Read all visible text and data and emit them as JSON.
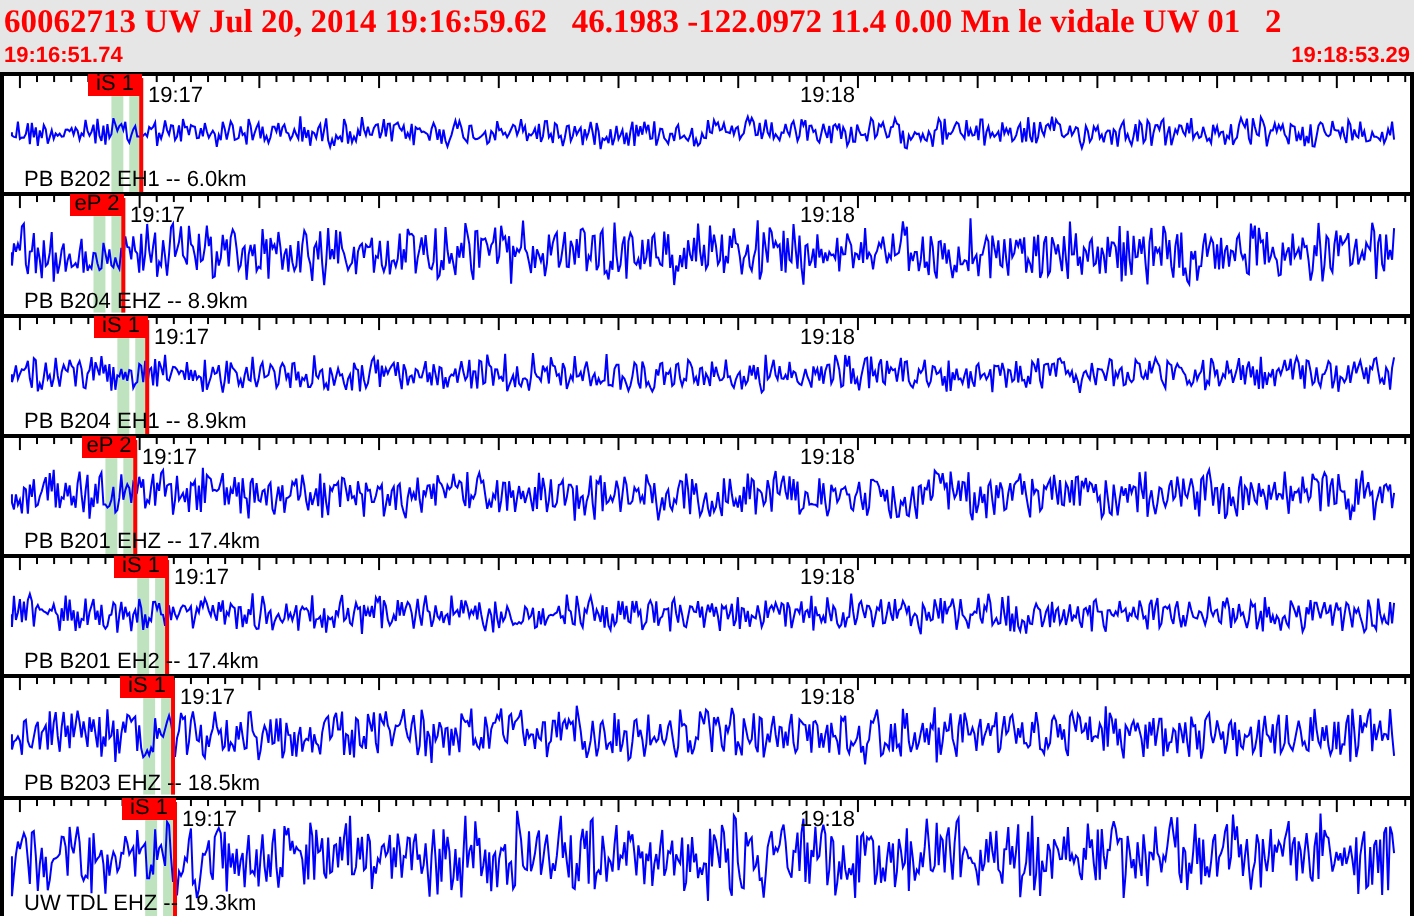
{
  "header": {
    "title": "60062713 UW Jul 20, 2014 19:16:59.62   46.1983 -122.0972 11.4 0.00 Mn le vidale UW 01   2",
    "start_time": "19:16:51.74",
    "end_time": "19:18:53.29"
  },
  "traces": [
    {
      "channel": "PB B202 EH1 -- 6.0km",
      "tick_labels": [
        "19:17",
        "19:18"
      ],
      "pick": "iS 1"
    },
    {
      "channel": "PB B204 EHZ -- 8.9km",
      "tick_labels": [
        "19:17",
        "19:18"
      ],
      "pick": "eP 2"
    },
    {
      "channel": "PB B204 EH1 -- 8.9km",
      "tick_labels": [
        "19:17",
        "19:18"
      ],
      "pick": "iS 1"
    },
    {
      "channel": "PB B201 EHZ -- 17.4km",
      "tick_labels": [
        "19:17",
        "19:18"
      ],
      "pick": "eP 2"
    },
    {
      "channel": "PB B201 EH2 -- 17.4km",
      "tick_labels": [
        "19:17",
        "19:18"
      ],
      "pick": "iS 1"
    },
    {
      "channel": "PB B203 EHZ -- 18.5km",
      "tick_labels": [
        "19:17",
        "19:18"
      ],
      "pick": "iS 1"
    },
    {
      "channel": "UW TDL EHZ -- 19.3km",
      "tick_labels": [
        "19:17",
        "19:18"
      ],
      "pick": "iS 1"
    }
  ]
}
